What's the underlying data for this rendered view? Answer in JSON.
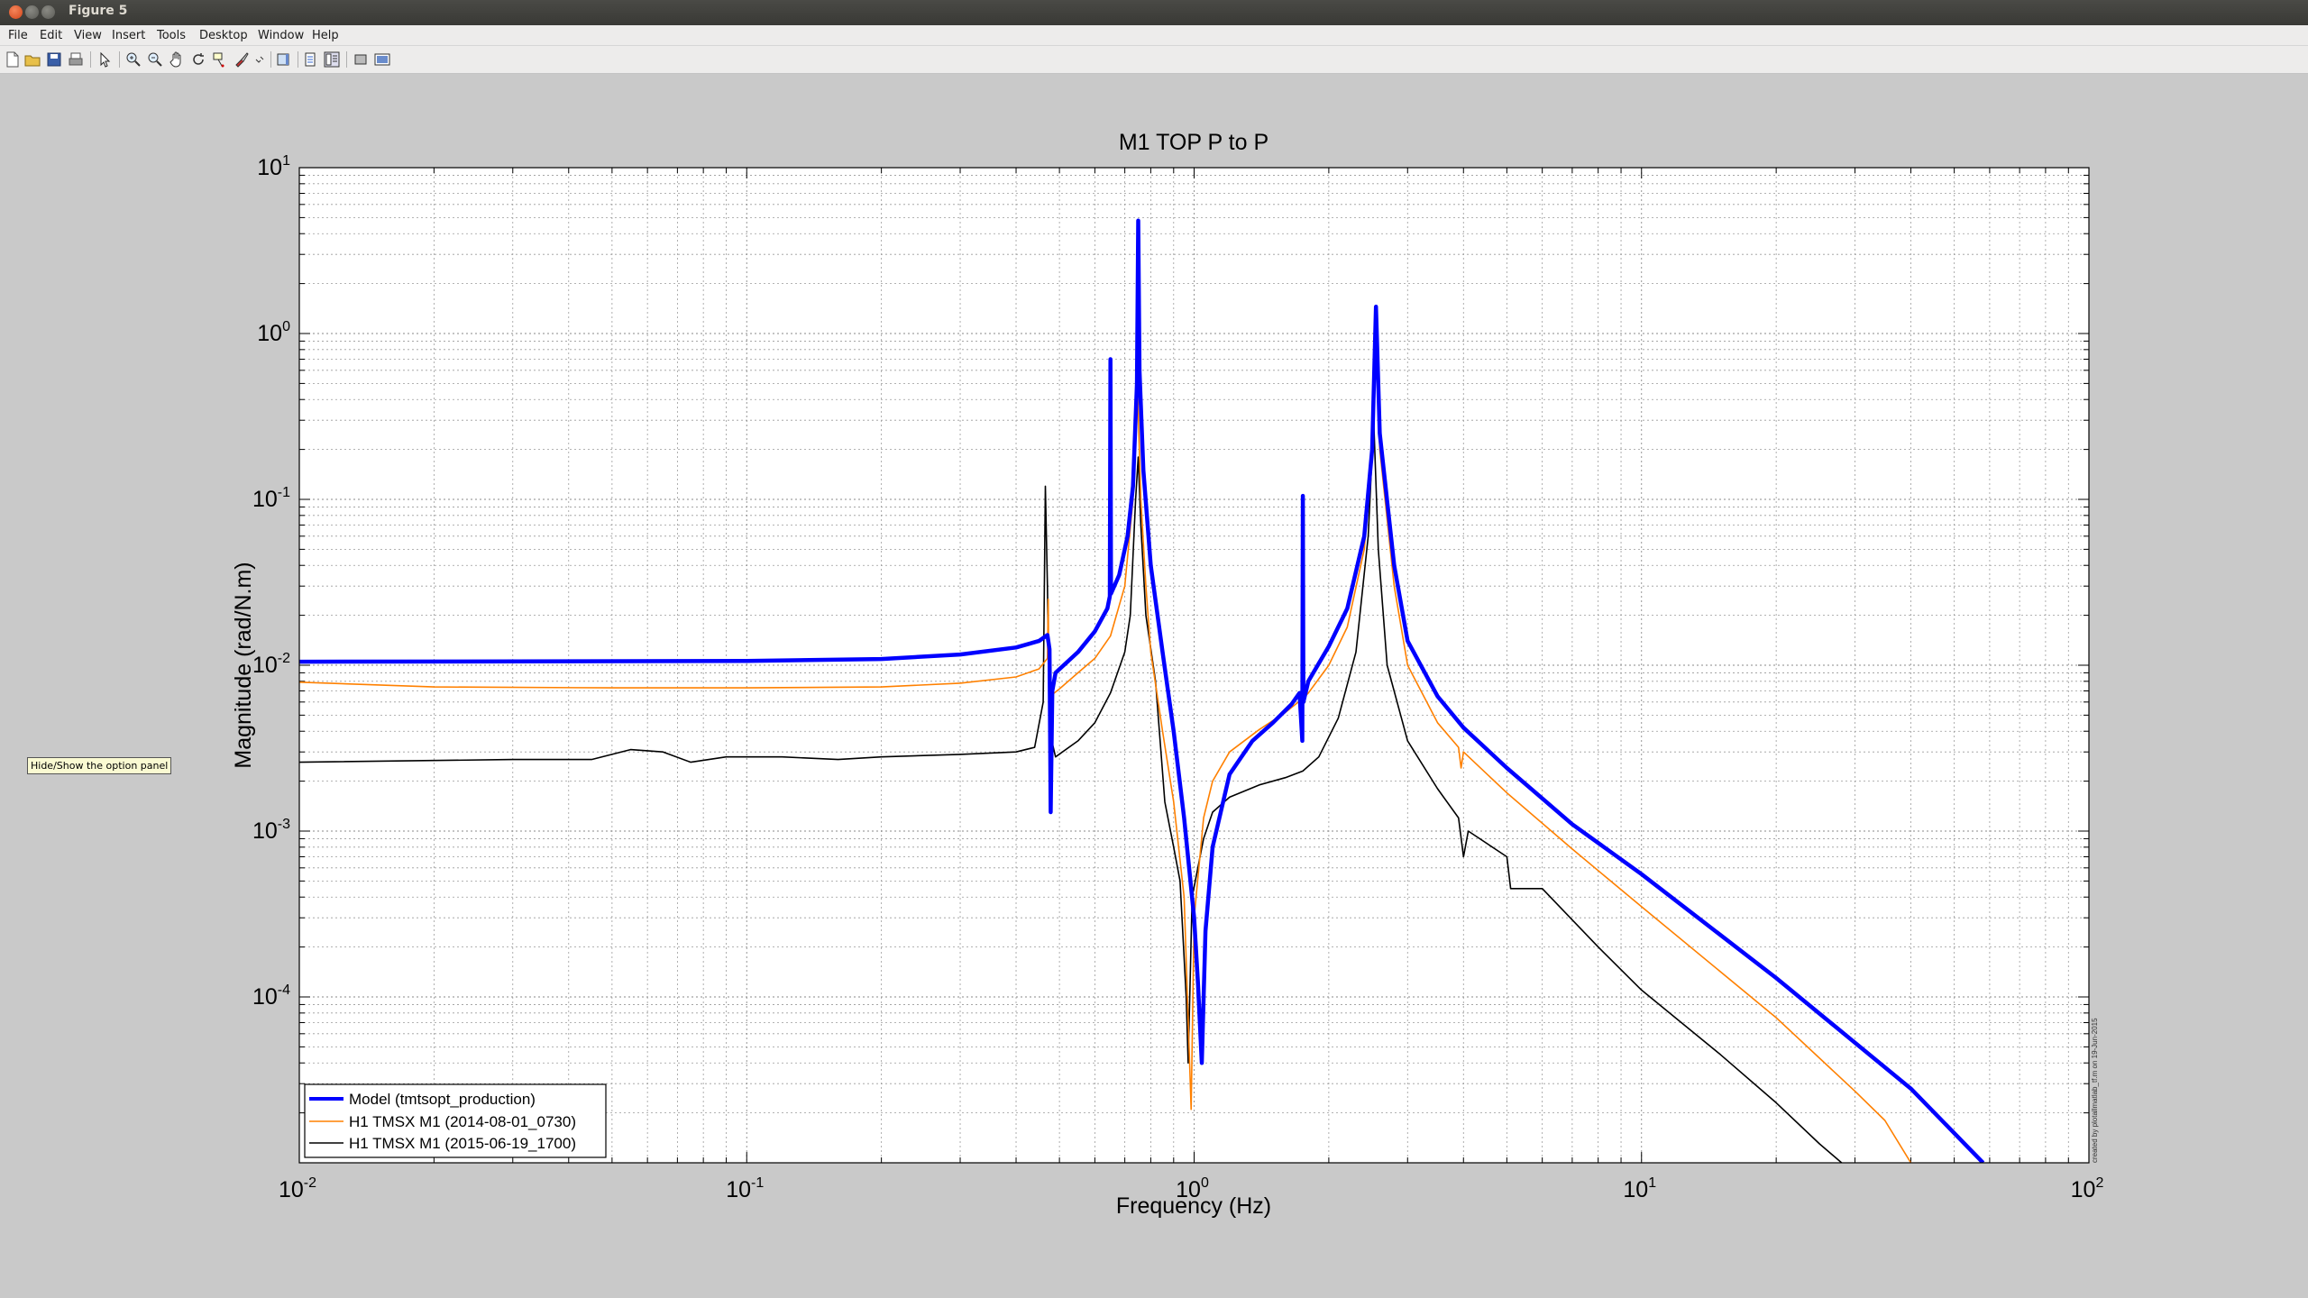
{
  "window": {
    "title": "Figure 5"
  },
  "menu": [
    "File",
    "Edit",
    "View",
    "Insert",
    "Tools",
    "Desktop",
    "Window",
    "Help"
  ],
  "toolbar": {
    "icons": [
      "new-figure-icon",
      "open-file-icon",
      "save-icon",
      "print-icon",
      "edit-plot-icon",
      "zoom-in-icon",
      "zoom-out-icon",
      "pan-icon",
      "rotate-3d-icon",
      "data-cursor-icon",
      "brush-icon",
      "link-plot-icon",
      "colorbar-icon",
      "legend-icon",
      "hide-plot-tools-icon",
      "show-plot-tools-icon"
    ]
  },
  "tooltip": "Hide/Show the option panel",
  "chart_data": {
    "type": "line",
    "title": "M1 TOP P to P",
    "xlabel": "Frequency (Hz)",
    "ylabel": "Magnitude (rad/N.m)",
    "xscale": "log",
    "yscale": "log",
    "xlim": [
      0.01,
      100
    ],
    "ylim": [
      1e-05,
      10
    ],
    "x_ticks": [
      {
        "base": "10",
        "exp": "-2"
      },
      {
        "base": "10",
        "exp": "-1"
      },
      {
        "base": "10",
        "exp": "0"
      },
      {
        "base": "10",
        "exp": "1"
      },
      {
        "base": "10",
        "exp": "2"
      }
    ],
    "y_ticks": [
      {
        "base": "10",
        "exp": "-4"
      },
      {
        "base": "10",
        "exp": "-3"
      },
      {
        "base": "10",
        "exp": "-2"
      },
      {
        "base": "10",
        "exp": "-1"
      },
      {
        "base": "10",
        "exp": "0"
      },
      {
        "base": "10",
        "exp": "1"
      }
    ],
    "grid": true,
    "legend_position": "bottom-left",
    "side_note": "created by plotallmatlab_tf.m on 19-Jun-2015",
    "series": [
      {
        "name": "Model (tmtsopt_production)",
        "color": "#0000ff",
        "linewidth": "thick",
        "points": [
          [
            0.01,
            0.0105
          ],
          [
            0.1,
            0.0106
          ],
          [
            0.2,
            0.0109
          ],
          [
            0.3,
            0.0116
          ],
          [
            0.4,
            0.0128
          ],
          [
            0.45,
            0.014
          ],
          [
            0.47,
            0.0152
          ],
          [
            0.475,
            0.0125
          ],
          [
            0.478,
            0.0013
          ],
          [
            0.482,
            0.007
          ],
          [
            0.49,
            0.009
          ],
          [
            0.55,
            0.012
          ],
          [
            0.6,
            0.016
          ],
          [
            0.64,
            0.022
          ],
          [
            0.648,
            0.026
          ],
          [
            0.65,
            0.7
          ],
          [
            0.652,
            0.027
          ],
          [
            0.68,
            0.035
          ],
          [
            0.71,
            0.06
          ],
          [
            0.73,
            0.12
          ],
          [
            0.745,
            0.5
          ],
          [
            0.75,
            4.8
          ],
          [
            0.755,
            0.6
          ],
          [
            0.77,
            0.15
          ],
          [
            0.8,
            0.04
          ],
          [
            0.85,
            0.012
          ],
          [
            0.9,
            0.004
          ],
          [
            0.95,
            0.0012
          ],
          [
            1.0,
            0.0003
          ],
          [
            1.02,
            0.00012
          ],
          [
            1.04,
            4e-05
          ],
          [
            1.06,
            0.00025
          ],
          [
            1.1,
            0.0008
          ],
          [
            1.2,
            0.0022
          ],
          [
            1.35,
            0.0035
          ],
          [
            1.5,
            0.0045
          ],
          [
            1.65,
            0.0058
          ],
          [
            1.72,
            0.0068
          ],
          [
            1.745,
            0.0035
          ],
          [
            1.75,
            0.105
          ],
          [
            1.755,
            0.006
          ],
          [
            1.8,
            0.008
          ],
          [
            2.0,
            0.013
          ],
          [
            2.2,
            0.022
          ],
          [
            2.4,
            0.06
          ],
          [
            2.5,
            0.2
          ],
          [
            2.55,
            1.45
          ],
          [
            2.6,
            0.25
          ],
          [
            2.8,
            0.04
          ],
          [
            3.0,
            0.014
          ],
          [
            3.5,
            0.0065
          ],
          [
            4.0,
            0.0042
          ],
          [
            5.0,
            0.0024
          ],
          [
            7.0,
            0.0011
          ],
          [
            10.0,
            0.00055
          ],
          [
            20.0,
            0.00013
          ],
          [
            40.0,
            2.8e-05
          ],
          [
            58.0,
            1e-05
          ]
        ]
      },
      {
        "name": "H1 TMSX  M1 (2014-08-01_0730)",
        "color": "#ff8000",
        "linewidth": "thin",
        "points": [
          [
            0.01,
            0.0079
          ],
          [
            0.02,
            0.0074
          ],
          [
            0.05,
            0.0073
          ],
          [
            0.1,
            0.0073
          ],
          [
            0.2,
            0.0074
          ],
          [
            0.3,
            0.0078
          ],
          [
            0.4,
            0.0085
          ],
          [
            0.45,
            0.0095
          ],
          [
            0.47,
            0.011
          ],
          [
            0.472,
            0.025
          ],
          [
            0.474,
            0.005
          ],
          [
            0.48,
            0.0066
          ],
          [
            0.5,
            0.0072
          ],
          [
            0.55,
            0.009
          ],
          [
            0.6,
            0.011
          ],
          [
            0.65,
            0.015
          ],
          [
            0.7,
            0.03
          ],
          [
            0.73,
            0.1
          ],
          [
            0.745,
            0.6
          ],
          [
            0.76,
            0.1
          ],
          [
            0.78,
            0.03
          ],
          [
            0.8,
            0.012
          ],
          [
            0.85,
            0.004
          ],
          [
            0.9,
            0.0015
          ],
          [
            0.95,
            0.0004
          ],
          [
            0.985,
            2.1e-05
          ],
          [
            1.0,
            0.0003
          ],
          [
            1.05,
            0.0012
          ],
          [
            1.1,
            0.002
          ],
          [
            1.2,
            0.003
          ],
          [
            1.4,
            0.0041
          ],
          [
            1.6,
            0.0052
          ],
          [
            1.75,
            0.0063
          ],
          [
            1.8,
            0.0068
          ],
          [
            2.0,
            0.01
          ],
          [
            2.2,
            0.017
          ],
          [
            2.4,
            0.05
          ],
          [
            2.5,
            0.2
          ],
          [
            2.55,
            0.85
          ],
          [
            2.6,
            0.2
          ],
          [
            2.8,
            0.03
          ],
          [
            3.0,
            0.01
          ],
          [
            3.5,
            0.0045
          ],
          [
            3.9,
            0.0032
          ],
          [
            3.95,
            0.0024
          ],
          [
            4.0,
            0.003
          ],
          [
            5.0,
            0.0017
          ],
          [
            7.0,
            0.00078
          ],
          [
            10.0,
            0.00035
          ],
          [
            20.0,
            7.5e-05
          ],
          [
            30.0,
            2.7e-05
          ],
          [
            35.0,
            1.8e-05
          ],
          [
            40.0,
            1e-05
          ]
        ]
      },
      {
        "name": "H1 TMSX  M1 (2015-06-19_1700)",
        "color": "#000000",
        "linewidth": "thin",
        "points": [
          [
            0.01,
            0.0026
          ],
          [
            0.03,
            0.0027
          ],
          [
            0.045,
            0.0027
          ],
          [
            0.055,
            0.0031
          ],
          [
            0.065,
            0.003
          ],
          [
            0.075,
            0.0026
          ],
          [
            0.09,
            0.0028
          ],
          [
            0.12,
            0.0028
          ],
          [
            0.16,
            0.0027
          ],
          [
            0.2,
            0.0028
          ],
          [
            0.3,
            0.0029
          ],
          [
            0.4,
            0.003
          ],
          [
            0.44,
            0.0032
          ],
          [
            0.46,
            0.006
          ],
          [
            0.465,
            0.12
          ],
          [
            0.47,
            0.03
          ],
          [
            0.475,
            0.004
          ],
          [
            0.49,
            0.0028
          ],
          [
            0.55,
            0.0035
          ],
          [
            0.6,
            0.0045
          ],
          [
            0.65,
            0.0068
          ],
          [
            0.7,
            0.012
          ],
          [
            0.72,
            0.02
          ],
          [
            0.74,
            0.1
          ],
          [
            0.75,
            0.18
          ],
          [
            0.76,
            0.07
          ],
          [
            0.78,
            0.02
          ],
          [
            0.82,
            0.008
          ],
          [
            0.86,
            0.0015
          ],
          [
            0.9,
            0.0008
          ],
          [
            0.93,
            0.0005
          ],
          [
            0.96,
            0.0001
          ],
          [
            0.97,
            4e-05
          ],
          [
            0.99,
            0.0004
          ],
          [
            1.05,
            0.0009
          ],
          [
            1.1,
            0.0013
          ],
          [
            1.2,
            0.0016
          ],
          [
            1.4,
            0.0019
          ],
          [
            1.6,
            0.0021
          ],
          [
            1.75,
            0.0023
          ],
          [
            1.9,
            0.0028
          ],
          [
            2.1,
            0.0048
          ],
          [
            2.3,
            0.012
          ],
          [
            2.45,
            0.06
          ],
          [
            2.52,
            0.3
          ],
          [
            2.58,
            0.05
          ],
          [
            2.7,
            0.01
          ],
          [
            3.0,
            0.0035
          ],
          [
            3.5,
            0.0018
          ],
          [
            3.9,
            0.0012
          ],
          [
            4.0,
            0.0007
          ],
          [
            4.1,
            0.001
          ],
          [
            5.0,
            0.0007
          ],
          [
            5.1,
            0.00045
          ],
          [
            6.0,
            0.00045
          ],
          [
            8.0,
            0.0002
          ],
          [
            10.0,
            0.00011
          ],
          [
            15.0,
            4.5e-05
          ],
          [
            20.0,
            2.3e-05
          ],
          [
            25.0,
            1.3e-05
          ],
          [
            28.0,
            1e-05
          ]
        ]
      }
    ]
  }
}
